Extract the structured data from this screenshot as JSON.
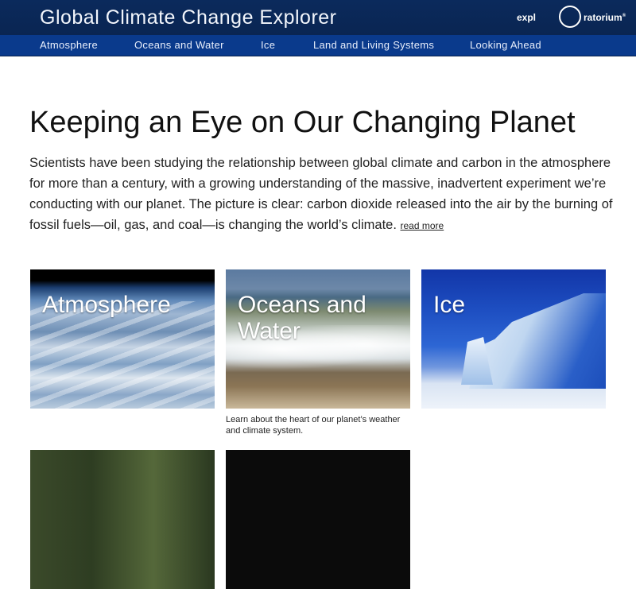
{
  "header": {
    "site_title": "Global Climate Change Explorer",
    "logo_pre": "expl",
    "logo_post": "ratorium",
    "logo_mark": "®"
  },
  "nav": {
    "items": [
      {
        "label": "Atmosphere"
      },
      {
        "label": "Oceans and Water"
      },
      {
        "label": "Ice"
      },
      {
        "label": "Land and Living Systems"
      },
      {
        "label": "Looking Ahead"
      }
    ]
  },
  "main": {
    "headline": "Keeping an Eye on Our Changing Planet",
    "intro": "Scientists have been studying the relationship between global climate and carbon in the atmosphere for more than a century, with a growing understanding of the massive, inadvertent experiment we’re conducting with our planet. The picture is clear: carbon dioxide released into the air by the burning of fossil fuels—oil, gas, and coal—is changing the world’s climate.",
    "read_more": "read more"
  },
  "cards": [
    {
      "label": "Atmosphere",
      "caption": ""
    },
    {
      "label": "Oceans and Water",
      "caption": "Learn about the heart of our planet’s weather and climate system."
    },
    {
      "label": "Ice",
      "caption": ""
    },
    {
      "label": "",
      "caption": ""
    },
    {
      "label": "",
      "caption": ""
    }
  ],
  "colors": {
    "header_bg": "#0b2a5c",
    "nav_bg": "#0a3a8c",
    "text": "#222222"
  }
}
